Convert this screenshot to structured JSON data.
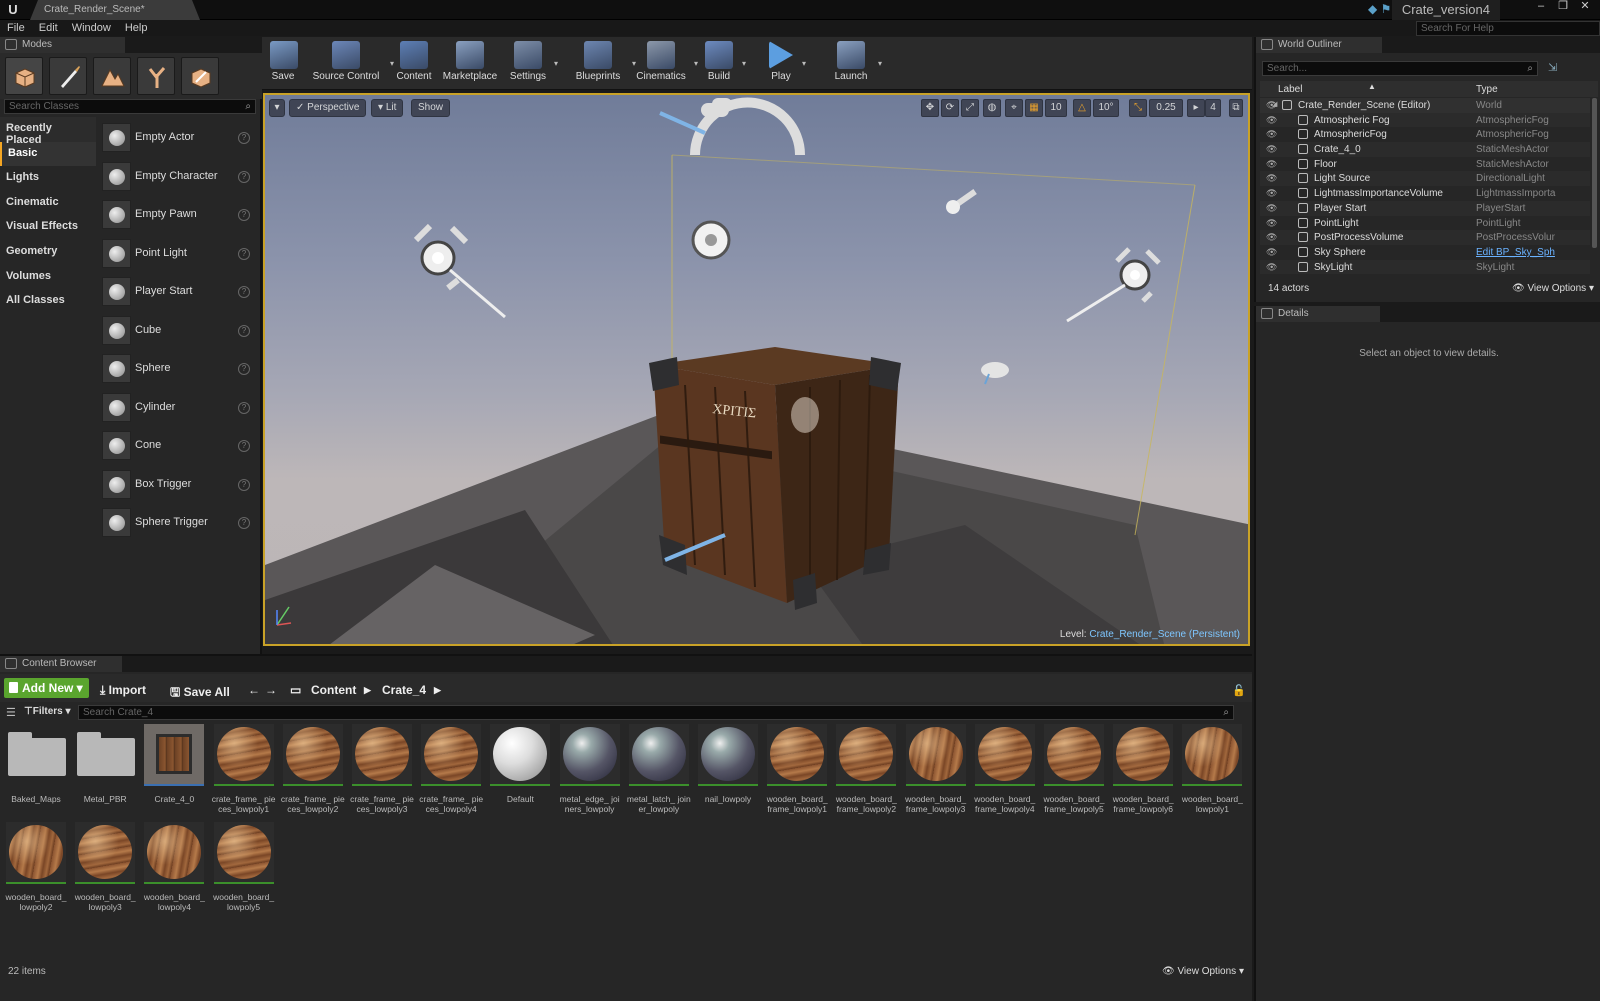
{
  "window": {
    "doc_tab": "Crate_Render_Scene*",
    "project": "Crate_version4",
    "help_search_placeholder": "Search For Help"
  },
  "menu": [
    "File",
    "Edit",
    "Window",
    "Help"
  ],
  "modes": {
    "tab": "Modes",
    "search_placeholder": "Search Classes",
    "categories": [
      "Recently Placed",
      "Basic",
      "Lights",
      "Cinematic",
      "Visual Effects",
      "Geometry",
      "Volumes",
      "All Classes"
    ],
    "selected_category": "Basic",
    "classes": [
      "Empty Actor",
      "Empty Character",
      "Empty Pawn",
      "Point Light",
      "Player Start",
      "Cube",
      "Sphere",
      "Cylinder",
      "Cone",
      "Box Trigger",
      "Sphere Trigger"
    ]
  },
  "toolbar": {
    "buttons": [
      "Save",
      "Source Control",
      "Content",
      "Marketplace",
      "Settings",
      "Blueprints",
      "Cinematics",
      "Build",
      "Play",
      "Launch"
    ]
  },
  "viewport": {
    "perspective": "Perspective",
    "lit": "Lit",
    "show": "Show",
    "grid_snap": "10",
    "rot_snap": "10°",
    "scale_snap": "0.25",
    "cam_speed": "4",
    "level_prefix": "Level:",
    "level_name": "Crate_Render_Scene (Persistent)"
  },
  "outliner": {
    "tab": "World Outliner",
    "search_placeholder": "Search...",
    "col_label": "Label",
    "col_type": "Type",
    "rows": [
      {
        "label": "Crate_Render_Scene (Editor)",
        "type": "World"
      },
      {
        "label": "Atmospheric Fog",
        "type": "AtmosphericFog"
      },
      {
        "label": "AtmosphericFog",
        "type": "AtmosphericFog"
      },
      {
        "label": "Crate_4_0",
        "type": "StaticMeshActor"
      },
      {
        "label": "Floor",
        "type": "StaticMeshActor"
      },
      {
        "label": "Light Source",
        "type": "DirectionalLight"
      },
      {
        "label": "LightmassImportanceVolume",
        "type": "LightmassImporta"
      },
      {
        "label": "Player Start",
        "type": "PlayerStart"
      },
      {
        "label": "PointLight",
        "type": "PointLight"
      },
      {
        "label": "PostProcessVolume",
        "type": "PostProcessVolur"
      },
      {
        "label": "Sky Sphere",
        "type": "Edit BP_Sky_Sph"
      },
      {
        "label": "SkyLight",
        "type": "SkyLight"
      }
    ],
    "count": "14 actors",
    "view_options": "View Options"
  },
  "details": {
    "tab": "Details",
    "message": "Select an object to view details."
  },
  "content_browser": {
    "tab": "Content Browser",
    "add_new": "Add New",
    "import": "Import",
    "save_all": "Save All",
    "path": [
      "Content",
      "Crate_4"
    ],
    "filters": "Filters",
    "search_placeholder": "Search Crate_4",
    "assets": [
      {
        "name": "Baked_Maps",
        "kind": "folder"
      },
      {
        "name": "Metal_PBR",
        "kind": "folder"
      },
      {
        "name": "Crate_4_0",
        "kind": "mesh"
      },
      {
        "name": "crate_frame_ pieces_lowpoly1",
        "kind": "wood"
      },
      {
        "name": "crate_frame_ pieces_lowpoly2",
        "kind": "wood"
      },
      {
        "name": "crate_frame_ pieces_lowpoly3",
        "kind": "wood"
      },
      {
        "name": "crate_frame_ pieces_lowpoly4",
        "kind": "wood"
      },
      {
        "name": "Default",
        "kind": "white"
      },
      {
        "name": "metal_edge_ joiners_lowpoly",
        "kind": "metal"
      },
      {
        "name": "metal_latch_ joiner_lowpoly",
        "kind": "metal"
      },
      {
        "name": "nail_lowpoly",
        "kind": "metal"
      },
      {
        "name": "wooden_board_ frame_lowpoly1",
        "kind": "wood"
      },
      {
        "name": "wooden_board_ frame_lowpoly2",
        "kind": "wood"
      },
      {
        "name": "wooden_board_ frame_lowpoly3",
        "kind": "wood2"
      },
      {
        "name": "wooden_board_ frame_lowpoly4",
        "kind": "wood"
      },
      {
        "name": "wooden_board_ frame_lowpoly5",
        "kind": "wood"
      },
      {
        "name": "wooden_board_ frame_lowpoly6",
        "kind": "wood"
      },
      {
        "name": "wooden_board_ lowpoly1",
        "kind": "wood2"
      },
      {
        "name": "wooden_board_ lowpoly2",
        "kind": "wood2"
      },
      {
        "name": "wooden_board_ lowpoly3",
        "kind": "wood"
      },
      {
        "name": "wooden_board_ lowpoly4",
        "kind": "wood2"
      },
      {
        "name": "wooden_board_ lowpoly5",
        "kind": "wood"
      }
    ],
    "count": "22 items",
    "view_options": "View Options"
  },
  "colors": {
    "accent": "#c9a227",
    "add_new": "#5aa52e",
    "link": "#6ab2ff"
  }
}
